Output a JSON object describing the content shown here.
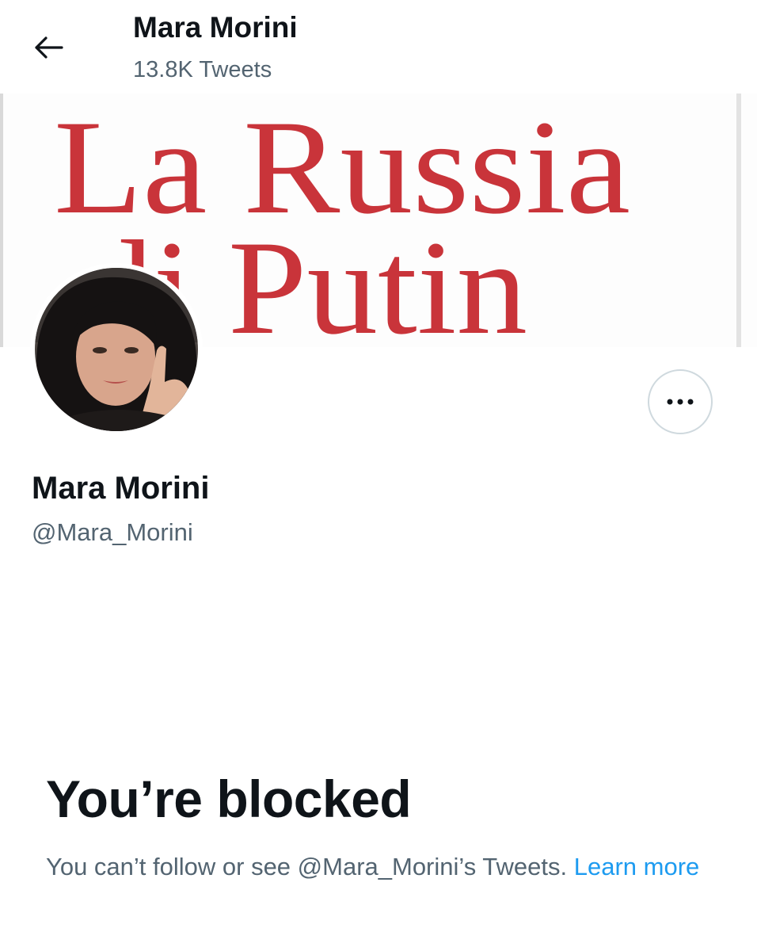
{
  "header": {
    "title": "Mara Morini",
    "subtitle": "13.8K Tweets"
  },
  "banner": {
    "line1": "La Russia",
    "line2": "di Putin",
    "text_color": "#c9343a"
  },
  "profile": {
    "display_name": "Mara Morini",
    "handle": "@Mara_Morini"
  },
  "blocked": {
    "title": "You’re blocked",
    "message": "You can’t follow or see @Mara_Morini’s Tweets.",
    "link_label": "Learn more",
    "link_color": "#1d9bf0"
  },
  "icons": {
    "back": "arrow-left-icon",
    "more": "more-horizontal-icon"
  }
}
